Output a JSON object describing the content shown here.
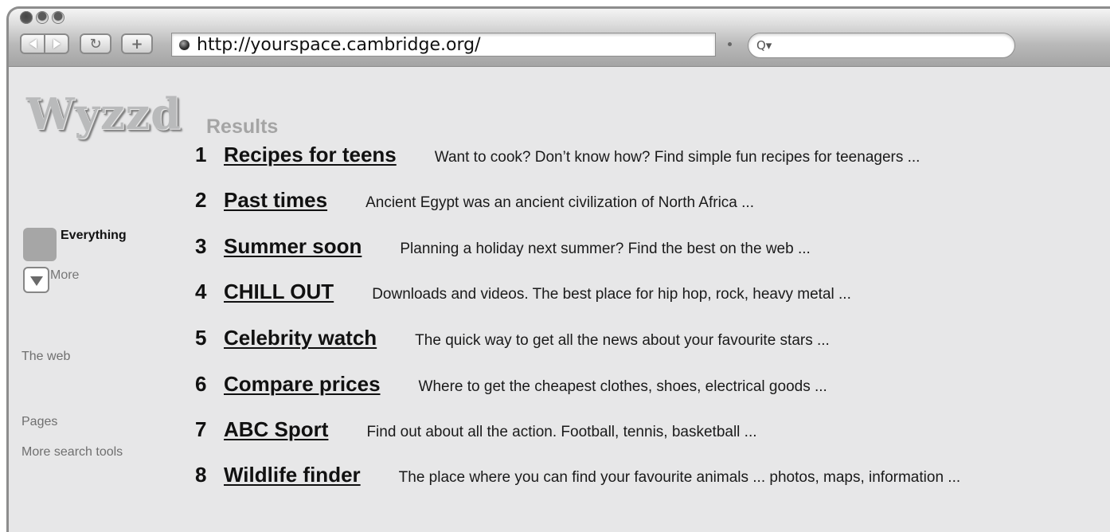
{
  "browser": {
    "url": "http://yourspace.cambridge.org/",
    "search_placeholder": "",
    "search_icon_glyph": "Q▾"
  },
  "logo": "Wyzzd",
  "results_heading": "Results",
  "sidebar": {
    "everything": "Everything",
    "more": "More",
    "links": [
      "The web",
      "Pages",
      "More search tools"
    ]
  },
  "results": [
    {
      "num": "1",
      "title": "Recipes for teens",
      "desc": "Want to cook? Don’t know how? Find simple fun recipes for teenagers ..."
    },
    {
      "num": "2",
      "title": "Past times",
      "desc": "Ancient Egypt was an ancient civilization of North Africa ..."
    },
    {
      "num": "3",
      "title": "Summer soon",
      "desc": "Planning a holiday next summer? Find the best on the web ..."
    },
    {
      "num": "4",
      "title": "CHILL OUT",
      "desc": "Downloads and videos. The best place for hip hop, rock, heavy metal ..."
    },
    {
      "num": "5",
      "title": "Celebrity watch",
      "desc": "The quick way to get all the news about your favourite stars ..."
    },
    {
      "num": "6",
      "title": "Compare prices",
      "desc": "Where to get the cheapest clothes, shoes, electrical goods ..."
    },
    {
      "num": "7",
      "title": "ABC Sport",
      "desc": "Find out about all the action. Football, tennis, basketball ..."
    },
    {
      "num": "8",
      "title": "Wildlife finder",
      "desc": "The place where you can find your favourite animals ... photos, maps, information ..."
    }
  ]
}
